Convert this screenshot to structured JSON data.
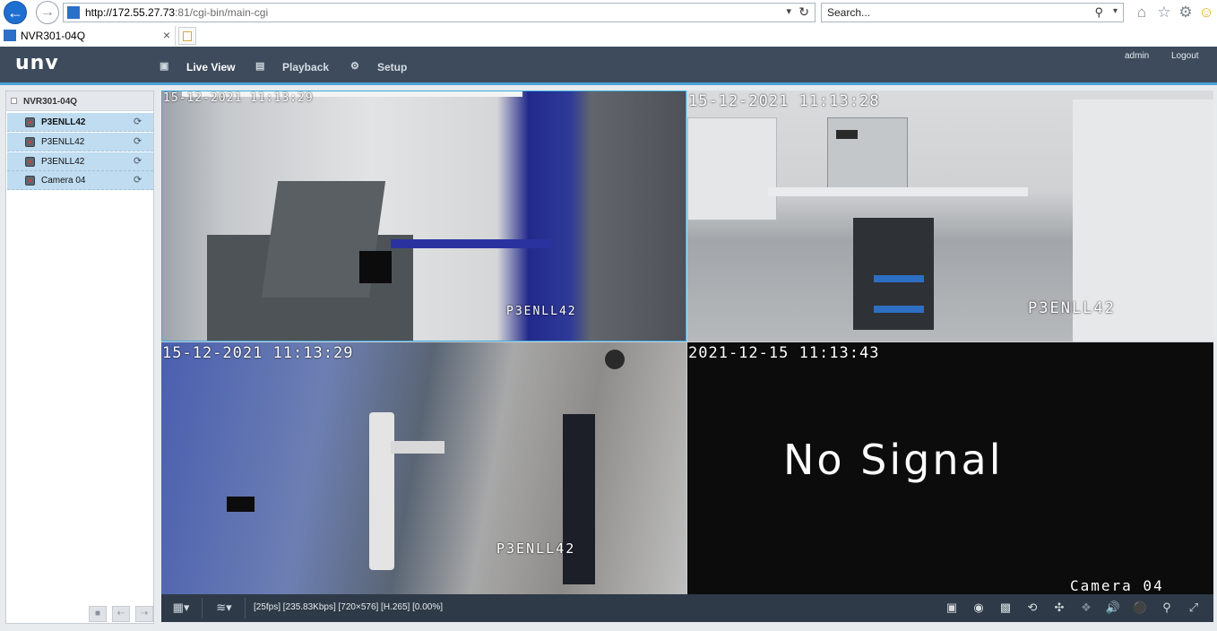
{
  "browser": {
    "url_host": "http://172.55.27.73",
    "url_rest": ":81/cgi-bin/main-cgi",
    "search_placeholder": "Search...",
    "tab_title": "NVR301-04Q"
  },
  "app": {
    "logo": "unv",
    "menu": [
      {
        "label": "Live View",
        "icon": "monitor-icon",
        "active": true
      },
      {
        "label": "Playback",
        "icon": "film-icon"
      },
      {
        "label": "Setup",
        "icon": "gear-icon"
      }
    ],
    "user": "admin",
    "logout": "Logout"
  },
  "sidebar": {
    "device": "NVR301-04Q",
    "cameras": [
      {
        "label": "P3ENLL42"
      },
      {
        "label": "P3ENLL42"
      },
      {
        "label": "P3ENLL42"
      },
      {
        "label": "Camera 04"
      }
    ]
  },
  "tiles": [
    {
      "timestamp": "15-12-2021 11:13:29",
      "camera": "P3ENLL42"
    },
    {
      "timestamp": "15-12-2021 11:13:28",
      "camera": "P3ENLL42"
    },
    {
      "timestamp": "15-12-2021 11:13:29",
      "camera": "P3ENLL42"
    },
    {
      "timestamp": "2021-12-15 11:13:43",
      "camera": "Camera 04",
      "message": "No Signal"
    }
  ],
  "toolbar": {
    "stats": "[25fps] [235.83Kbps] [720×576] [H.265] [0.00%]"
  },
  "colors": {
    "header": "#3d4b5c",
    "accent": "#4aa3d6",
    "selected_row": "#bfdcf0"
  }
}
